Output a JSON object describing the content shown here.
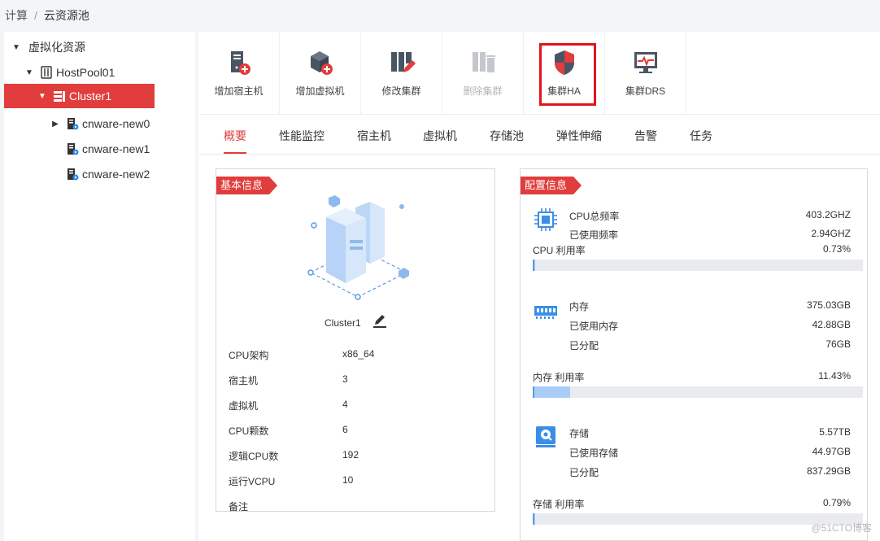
{
  "breadcrumb": {
    "root": "计算",
    "separator": "/",
    "current": "云资源池"
  },
  "tree": {
    "root": "虚拟化资源",
    "pool": "HostPool01",
    "cluster": "Cluster1",
    "hosts": [
      "cnware-new0",
      "cnware-new1",
      "cnware-new2"
    ]
  },
  "toolbar": [
    {
      "label": "增加宿主机",
      "icon": "add-host-icon",
      "disabled": false
    },
    {
      "label": "增加虚拟机",
      "icon": "add-vm-icon",
      "disabled": false
    },
    {
      "label": "修改集群",
      "icon": "edit-cluster-icon",
      "disabled": false
    },
    {
      "label": "删除集群",
      "icon": "delete-cluster-icon",
      "disabled": true
    },
    {
      "label": "集群HA",
      "icon": "shield-icon",
      "disabled": false
    },
    {
      "label": "集群DRS",
      "icon": "monitor-icon",
      "disabled": false
    }
  ],
  "tabs": [
    "概要",
    "性能监控",
    "宿主机",
    "虚拟机",
    "存储池",
    "弹性伸缩",
    "告警",
    "任务"
  ],
  "basic_info": {
    "title": "基本信息",
    "cluster_name": "Cluster1",
    "rows": [
      {
        "label": "CPU架构",
        "value": "x86_64"
      },
      {
        "label": "宿主机",
        "value": "3"
      },
      {
        "label": "虚拟机",
        "value": "4"
      },
      {
        "label": "CPU颗数",
        "value": "6"
      },
      {
        "label": "逻辑CPU数",
        "value": "192"
      },
      {
        "label": "运行VCPU",
        "value": "10"
      },
      {
        "label": "备注",
        "value": ""
      }
    ]
  },
  "config_info": {
    "title": "配置信息",
    "cpu": {
      "total_label": "CPU总频率",
      "total_value": "403.2GHZ",
      "used_label": "已使用频率",
      "used_value": "2.94GHZ",
      "usage_label": "CPU 利用率",
      "usage_value": "0.73%",
      "usage_fraction": 0.0073
    },
    "memory": {
      "total_label": "内存",
      "total_value": "375.03GB",
      "used_label": "已使用内存",
      "used_value": "42.88GB",
      "alloc_label": "已分配",
      "alloc_value": "76GB",
      "usage_label": "内存 利用率",
      "usage_value": "11.43%",
      "usage_fraction": 0.1143
    },
    "storage": {
      "total_label": "存储",
      "total_value": "5.57TB",
      "used_label": "已使用存储",
      "used_value": "44.97GB",
      "alloc_label": "已分配",
      "alloc_value": "837.29GB",
      "usage_label": "存储 利用率",
      "usage_value": "0.79%",
      "usage_fraction": 0.0079
    }
  },
  "colors": {
    "accent": "#e03d3c",
    "bar_fill": "#a9cdf6",
    "highlight_box": "#e2141c"
  },
  "watermark": "@51CTO博客"
}
